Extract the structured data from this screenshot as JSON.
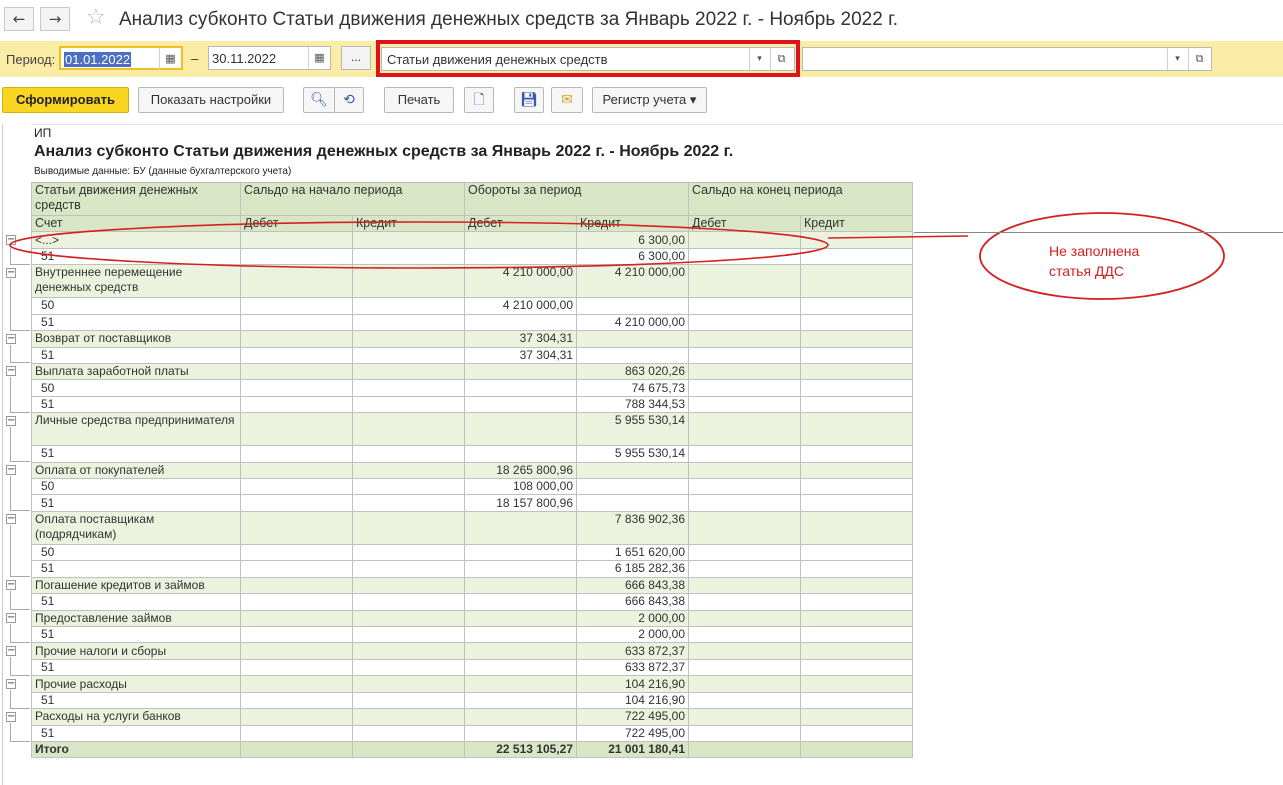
{
  "window": {
    "title": "Анализ субконто Статьи движения денежных средств за Январь 2022 г. - Ноябрь 2022 г.",
    "back_icon": "←",
    "forward_icon": "→",
    "star_icon": "☆"
  },
  "period": {
    "label": "Период:",
    "from": "01.01.2022",
    "to": "30.11.2022",
    "dash": "–",
    "more_label": "...",
    "subconto_value": "Статьи движения денежных средств",
    "subconto2_value": ""
  },
  "toolbar": {
    "generate_label": "Сформировать",
    "settings_label": "Показать настройки",
    "print_label": "Печать",
    "register_label": "Регистр учета ▾"
  },
  "report": {
    "company": "ИП",
    "title": "Анализ субконто Статьи движения денежных средств за Январь 2022 г. - Ноябрь 2022 г.",
    "note": "Выводимые данные: БУ (данные бухгалтерского учета)",
    "headers": {
      "col1": "Статьи движения денежных средств",
      "col1b": "Счет",
      "opening": "Сальдо на начало периода",
      "turnover": "Обороты за период",
      "closing": "Сальдо на конец периода",
      "debit": "Дебет",
      "credit": "Кредит"
    },
    "rows": [
      {
        "name": "<...>",
        "level": 0,
        "od": "",
        "oc": "",
        "td": "",
        "tc": "6 300,00",
        "cd": "",
        "cc": "",
        "h": 1
      },
      {
        "name": "51",
        "level": 1,
        "od": "",
        "oc": "",
        "td": "",
        "tc": "6 300,00",
        "cd": "",
        "cc": "",
        "h": 1
      },
      {
        "name": "Внутреннее перемещение денежных средств",
        "level": 0,
        "od": "",
        "oc": "",
        "td": "4 210 000,00",
        "tc": "4 210 000,00",
        "cd": "",
        "cc": "",
        "h": 2
      },
      {
        "name": "50",
        "level": 1,
        "od": "",
        "oc": "",
        "td": "4 210 000,00",
        "tc": "",
        "cd": "",
        "cc": "",
        "h": 1
      },
      {
        "name": "51",
        "level": 1,
        "od": "",
        "oc": "",
        "td": "",
        "tc": "4 210 000,00",
        "cd": "",
        "cc": "",
        "h": 1
      },
      {
        "name": "Возврат от поставщиков",
        "level": 0,
        "od": "",
        "oc": "",
        "td": "37 304,31",
        "tc": "",
        "cd": "",
        "cc": "",
        "h": 1
      },
      {
        "name": "51",
        "level": 1,
        "od": "",
        "oc": "",
        "td": "37 304,31",
        "tc": "",
        "cd": "",
        "cc": "",
        "h": 1
      },
      {
        "name": "Выплата заработной платы",
        "level": 0,
        "od": "",
        "oc": "",
        "td": "",
        "tc": "863 020,26",
        "cd": "",
        "cc": "",
        "h": 1
      },
      {
        "name": "50",
        "level": 1,
        "od": "",
        "oc": "",
        "td": "",
        "tc": "74 675,73",
        "cd": "",
        "cc": "",
        "h": 1
      },
      {
        "name": "51",
        "level": 1,
        "od": "",
        "oc": "",
        "td": "",
        "tc": "788 344,53",
        "cd": "",
        "cc": "",
        "h": 1
      },
      {
        "name": "Личные средства предпринимателя",
        "level": 0,
        "od": "",
        "oc": "",
        "td": "",
        "tc": "5 955 530,14",
        "cd": "",
        "cc": "",
        "h": 2
      },
      {
        "name": "51",
        "level": 1,
        "od": "",
        "oc": "",
        "td": "",
        "tc": "5 955 530,14",
        "cd": "",
        "cc": "",
        "h": 1
      },
      {
        "name": "Оплата от покупателей",
        "level": 0,
        "od": "",
        "oc": "",
        "td": "18 265 800,96",
        "tc": "",
        "cd": "",
        "cc": "",
        "h": 1
      },
      {
        "name": "50",
        "level": 1,
        "od": "",
        "oc": "",
        "td": "108 000,00",
        "tc": "",
        "cd": "",
        "cc": "",
        "h": 1
      },
      {
        "name": "51",
        "level": 1,
        "od": "",
        "oc": "",
        "td": "18 157 800,96",
        "tc": "",
        "cd": "",
        "cc": "",
        "h": 1
      },
      {
        "name": "Оплата поставщикам (подрядчикам)",
        "level": 0,
        "od": "",
        "oc": "",
        "td": "",
        "tc": "7 836 902,36",
        "cd": "",
        "cc": "",
        "h": 2
      },
      {
        "name": "50",
        "level": 1,
        "od": "",
        "oc": "",
        "td": "",
        "tc": "1 651 620,00",
        "cd": "",
        "cc": "",
        "h": 1
      },
      {
        "name": "51",
        "level": 1,
        "od": "",
        "oc": "",
        "td": "",
        "tc": "6 185 282,36",
        "cd": "",
        "cc": "",
        "h": 1
      },
      {
        "name": "Погашение кредитов и займов",
        "level": 0,
        "od": "",
        "oc": "",
        "td": "",
        "tc": "666 843,38",
        "cd": "",
        "cc": "",
        "h": 1
      },
      {
        "name": "51",
        "level": 1,
        "od": "",
        "oc": "",
        "td": "",
        "tc": "666 843,38",
        "cd": "",
        "cc": "",
        "h": 1
      },
      {
        "name": "Предоставление займов",
        "level": 0,
        "od": "",
        "oc": "",
        "td": "",
        "tc": "2 000,00",
        "cd": "",
        "cc": "",
        "h": 1
      },
      {
        "name": "51",
        "level": 1,
        "od": "",
        "oc": "",
        "td": "",
        "tc": "2 000,00",
        "cd": "",
        "cc": "",
        "h": 1
      },
      {
        "name": "Прочие налоги и сборы",
        "level": 0,
        "od": "",
        "oc": "",
        "td": "",
        "tc": "633 872,37",
        "cd": "",
        "cc": "",
        "h": 1
      },
      {
        "name": "51",
        "level": 1,
        "od": "",
        "oc": "",
        "td": "",
        "tc": "633 872,37",
        "cd": "",
        "cc": "",
        "h": 1
      },
      {
        "name": "Прочие расходы",
        "level": 0,
        "od": "",
        "oc": "",
        "td": "",
        "tc": "104 216,90",
        "cd": "",
        "cc": "",
        "h": 1
      },
      {
        "name": "51",
        "level": 1,
        "od": "",
        "oc": "",
        "td": "",
        "tc": "104 216,90",
        "cd": "",
        "cc": "",
        "h": 1
      },
      {
        "name": "Расходы на услуги банков",
        "level": 0,
        "od": "",
        "oc": "",
        "td": "",
        "tc": "722 495,00",
        "cd": "",
        "cc": "",
        "h": 1
      },
      {
        "name": "51",
        "level": 1,
        "od": "",
        "oc": "",
        "td": "",
        "tc": "722 495,00",
        "cd": "",
        "cc": "",
        "h": 1
      }
    ],
    "total": {
      "name": "Итого",
      "od": "",
      "oc": "",
      "td": "22 513 105,27",
      "tc": "21 001 180,41",
      "cd": "",
      "cc": ""
    }
  },
  "annotation": {
    "text_line1": "Не заполнена",
    "text_line2": "статья ДДС",
    "color": "#d42020"
  },
  "colors": {
    "period_bar": "#fbeda6",
    "primary_button": "#f8d622",
    "highlight_box": "#e0121e",
    "header_fill": "#d9e6c6",
    "group_fill": "#ebf2de"
  }
}
